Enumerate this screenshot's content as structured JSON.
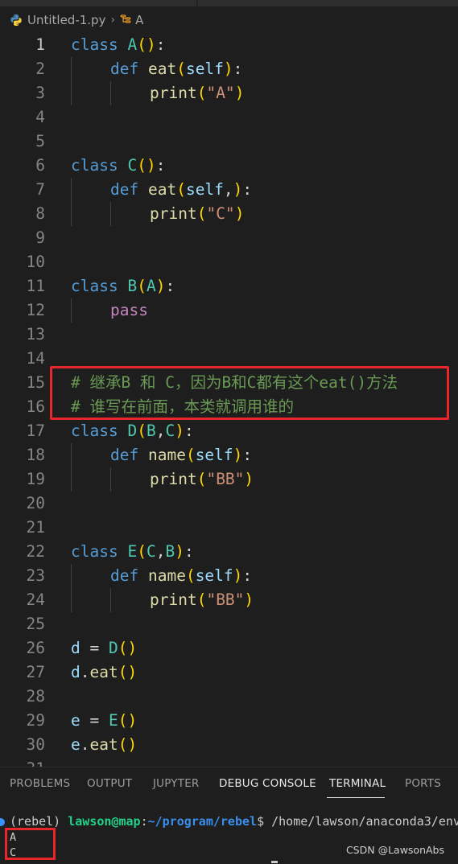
{
  "breadcrumb": {
    "file": "Untitled-1.py",
    "symbol": "A"
  },
  "code_lines": [
    {
      "n": "1",
      "active": true,
      "tokens": [
        {
          "t": "class ",
          "c": "kw"
        },
        {
          "t": "A",
          "c": "cls"
        },
        {
          "t": "()",
          "c": "br1"
        },
        {
          "t": ":",
          "c": "pl"
        }
      ]
    },
    {
      "n": "2",
      "indent": 1,
      "tokens": [
        {
          "t": "def ",
          "c": "kw"
        },
        {
          "t": "eat",
          "c": "fn"
        },
        {
          "t": "(",
          "c": "br1"
        },
        {
          "t": "self",
          "c": "slf"
        },
        {
          "t": ")",
          "c": "br1"
        },
        {
          "t": ":",
          "c": "pl"
        }
      ]
    },
    {
      "n": "3",
      "indent": 2,
      "tokens": [
        {
          "t": "print",
          "c": "fn"
        },
        {
          "t": "(",
          "c": "br1"
        },
        {
          "t": "\"A\"",
          "c": "str"
        },
        {
          "t": ")",
          "c": "br1"
        }
      ]
    },
    {
      "n": "4",
      "tokens": []
    },
    {
      "n": "5",
      "tokens": []
    },
    {
      "n": "6",
      "tokens": [
        {
          "t": "class ",
          "c": "kw"
        },
        {
          "t": "C",
          "c": "cls"
        },
        {
          "t": "()",
          "c": "br1"
        },
        {
          "t": ":",
          "c": "pl"
        }
      ]
    },
    {
      "n": "7",
      "indent": 1,
      "tokens": [
        {
          "t": "def ",
          "c": "kw"
        },
        {
          "t": "eat",
          "c": "fn"
        },
        {
          "t": "(",
          "c": "br1"
        },
        {
          "t": "self",
          "c": "slf"
        },
        {
          "t": ",",
          "c": "pl"
        },
        {
          "t": ")",
          "c": "br1"
        },
        {
          "t": ":",
          "c": "pl"
        }
      ]
    },
    {
      "n": "8",
      "indent": 2,
      "tokens": [
        {
          "t": "print",
          "c": "fn"
        },
        {
          "t": "(",
          "c": "br1"
        },
        {
          "t": "\"C\"",
          "c": "str"
        },
        {
          "t": ")",
          "c": "br1"
        }
      ]
    },
    {
      "n": "9",
      "tokens": []
    },
    {
      "n": "10",
      "tokens": []
    },
    {
      "n": "11",
      "tokens": [
        {
          "t": "class ",
          "c": "kw"
        },
        {
          "t": "B",
          "c": "cls"
        },
        {
          "t": "(",
          "c": "br1"
        },
        {
          "t": "A",
          "c": "cls"
        },
        {
          "t": ")",
          "c": "br1"
        },
        {
          "t": ":",
          "c": "pl"
        }
      ]
    },
    {
      "n": "12",
      "indent": 1,
      "tokens": [
        {
          "t": "pass",
          "c": "ctl"
        }
      ]
    },
    {
      "n": "13",
      "tokens": []
    },
    {
      "n": "14",
      "tokens": []
    },
    {
      "n": "15",
      "tokens": [
        {
          "t": "# 继承B 和 C，因为B和C都有这个eat()方法",
          "c": "cmt"
        }
      ]
    },
    {
      "n": "16",
      "tokens": [
        {
          "t": "# 谁写在前面，本类就调用谁的",
          "c": "cmt"
        }
      ]
    },
    {
      "n": "17",
      "tokens": [
        {
          "t": "class ",
          "c": "kw"
        },
        {
          "t": "D",
          "c": "cls"
        },
        {
          "t": "(",
          "c": "br1"
        },
        {
          "t": "B",
          "c": "cls"
        },
        {
          "t": ",",
          "c": "pl"
        },
        {
          "t": "C",
          "c": "cls"
        },
        {
          "t": ")",
          "c": "br1"
        },
        {
          "t": ":",
          "c": "pl"
        }
      ]
    },
    {
      "n": "18",
      "indent": 1,
      "tokens": [
        {
          "t": "def ",
          "c": "kw"
        },
        {
          "t": "name",
          "c": "fn"
        },
        {
          "t": "(",
          "c": "br1"
        },
        {
          "t": "self",
          "c": "slf"
        },
        {
          "t": ")",
          "c": "br1"
        },
        {
          "t": ":",
          "c": "pl"
        }
      ]
    },
    {
      "n": "19",
      "indent": 2,
      "tokens": [
        {
          "t": "print",
          "c": "fn"
        },
        {
          "t": "(",
          "c": "br1"
        },
        {
          "t": "\"BB\"",
          "c": "str"
        },
        {
          "t": ")",
          "c": "br1"
        }
      ]
    },
    {
      "n": "20",
      "tokens": []
    },
    {
      "n": "21",
      "tokens": []
    },
    {
      "n": "22",
      "tokens": [
        {
          "t": "class ",
          "c": "kw"
        },
        {
          "t": "E",
          "c": "cls"
        },
        {
          "t": "(",
          "c": "br1"
        },
        {
          "t": "C",
          "c": "cls"
        },
        {
          "t": ",",
          "c": "pl"
        },
        {
          "t": "B",
          "c": "cls"
        },
        {
          "t": ")",
          "c": "br1"
        },
        {
          "t": ":",
          "c": "pl"
        }
      ]
    },
    {
      "n": "23",
      "indent": 1,
      "tokens": [
        {
          "t": "def ",
          "c": "kw"
        },
        {
          "t": "name",
          "c": "fn"
        },
        {
          "t": "(",
          "c": "br1"
        },
        {
          "t": "self",
          "c": "slf"
        },
        {
          "t": ")",
          "c": "br1"
        },
        {
          "t": ":",
          "c": "pl"
        }
      ]
    },
    {
      "n": "24",
      "indent": 2,
      "tokens": [
        {
          "t": "print",
          "c": "fn"
        },
        {
          "t": "(",
          "c": "br1"
        },
        {
          "t": "\"BB\"",
          "c": "str"
        },
        {
          "t": ")",
          "c": "br1"
        }
      ]
    },
    {
      "n": "25",
      "tokens": []
    },
    {
      "n": "26",
      "tokens": [
        {
          "t": "d",
          "c": "var"
        },
        {
          "t": " = ",
          "c": "pl"
        },
        {
          "t": "D",
          "c": "cls"
        },
        {
          "t": "()",
          "c": "br1"
        }
      ]
    },
    {
      "n": "27",
      "tokens": [
        {
          "t": "d",
          "c": "var"
        },
        {
          "t": ".",
          "c": "pl"
        },
        {
          "t": "eat",
          "c": "fn"
        },
        {
          "t": "()",
          "c": "br1"
        }
      ]
    },
    {
      "n": "28",
      "tokens": []
    },
    {
      "n": "29",
      "tokens": [
        {
          "t": "e",
          "c": "var"
        },
        {
          "t": " = ",
          "c": "pl"
        },
        {
          "t": "E",
          "c": "cls"
        },
        {
          "t": "()",
          "c": "br1"
        }
      ]
    },
    {
      "n": "30",
      "tokens": [
        {
          "t": "e",
          "c": "var"
        },
        {
          "t": ".",
          "c": "pl"
        },
        {
          "t": "eat",
          "c": "fn"
        },
        {
          "t": "()",
          "c": "br1"
        }
      ]
    },
    {
      "n": "31",
      "tokens": []
    }
  ],
  "panel": {
    "tabs": [
      "PROBLEMS",
      "OUTPUT",
      "JUPYTER",
      "DEBUG CONSOLE",
      "TERMINAL",
      "PORTS"
    ],
    "active_tab": "TERMINAL"
  },
  "terminal": {
    "env": "(rebel) ",
    "user_host": "lawson@map",
    "colon": ":",
    "path": "~/program/rebel",
    "dollar": "$ ",
    "command": "/home/lawson/anaconda3/env",
    "output": [
      "A",
      "C"
    ]
  },
  "watermark": "CSDN @LawsonAbs",
  "colors": {
    "editor_bg": "#1e1e1e",
    "highlight_box": "#e8262b",
    "keyword": "#569cd6",
    "function": "#dcdcaa",
    "class_name": "#4ec9b0",
    "string": "#ce9178",
    "comment": "#6a9955"
  }
}
